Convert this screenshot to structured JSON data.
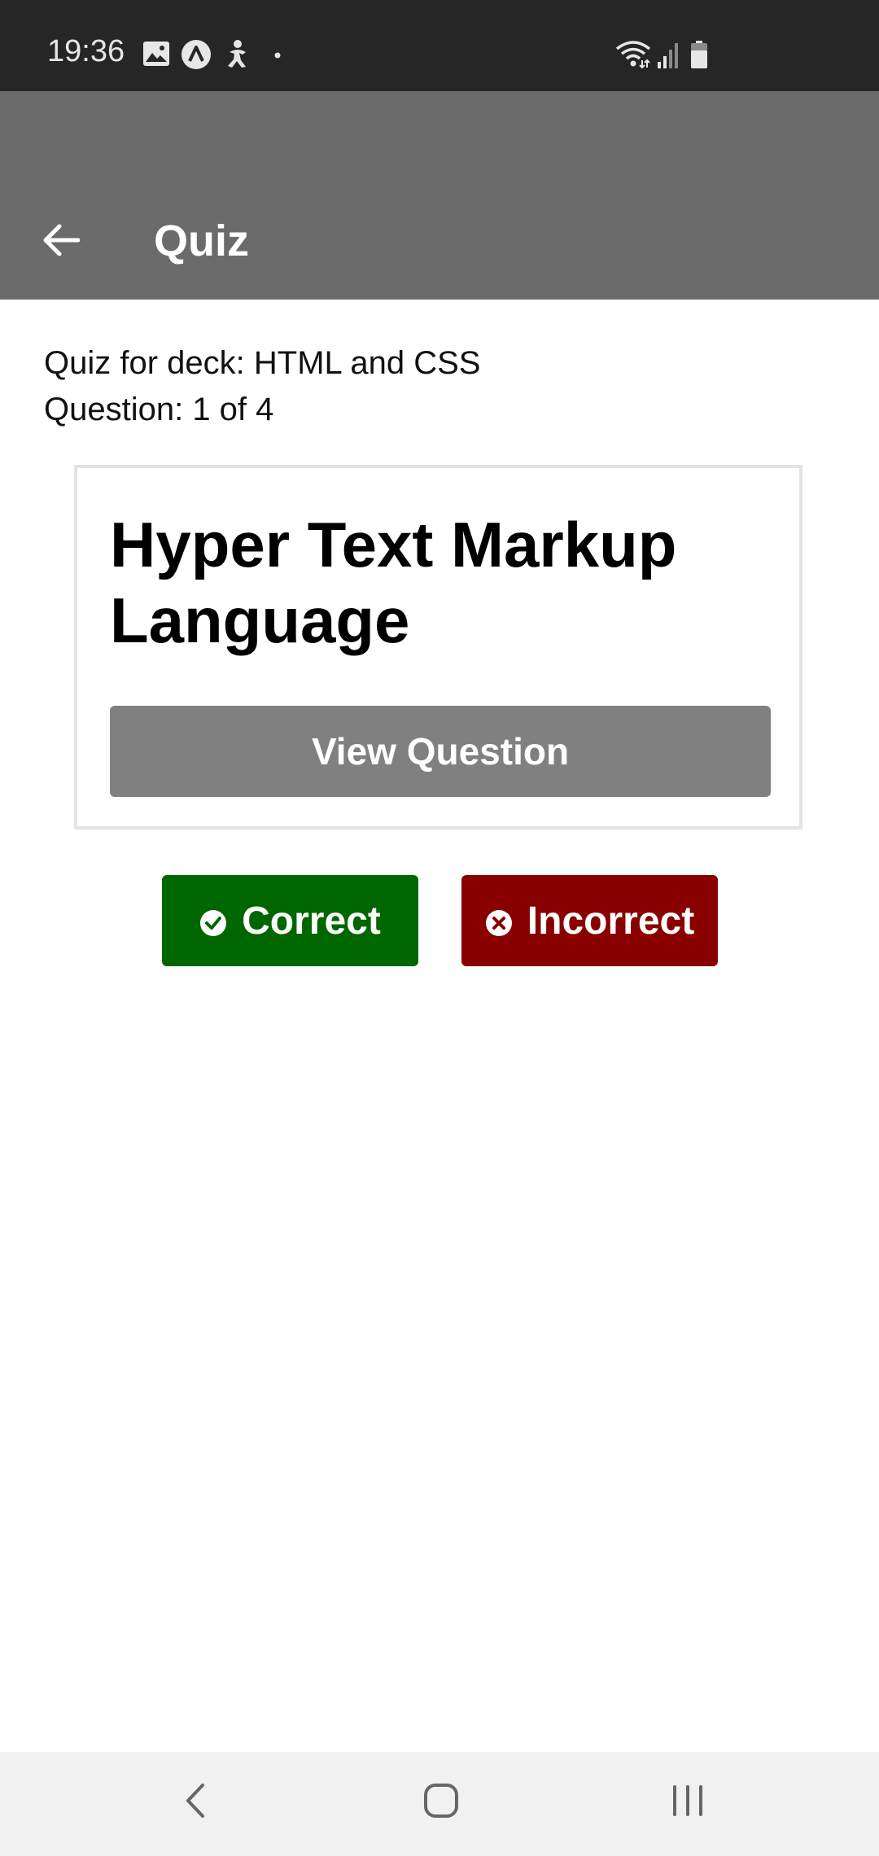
{
  "status_bar": {
    "time": "19:36",
    "icons": [
      "gallery-icon",
      "app-notification-icon",
      "accessibility-icon",
      "dot-icon",
      "wifi-icon",
      "signal-icon",
      "battery-icon"
    ]
  },
  "app_bar": {
    "title": "Quiz",
    "back_icon": "arrow-left-icon"
  },
  "quiz": {
    "deck_line": "Quiz for deck: HTML and CSS",
    "question_line": "Question: 1 of 4",
    "card": {
      "answer_text": "Hyper Text Markup Language",
      "view_question_label": "View Question"
    },
    "correct_label": "Correct",
    "incorrect_label": "Incorrect"
  },
  "colors": {
    "app_bar": "#6b6b6b",
    "status_bar": "#262626",
    "view_button": "#808080",
    "correct": "#006600",
    "incorrect": "#880000"
  },
  "nav_bar": {
    "buttons": [
      "back-nav-icon",
      "home-nav-icon",
      "recents-nav-icon"
    ]
  }
}
